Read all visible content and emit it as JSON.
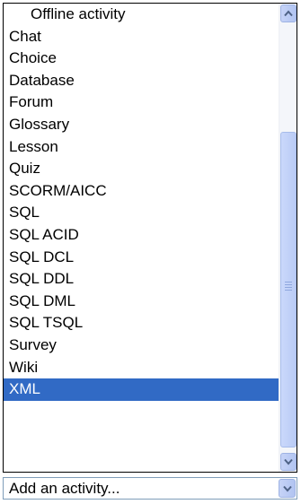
{
  "list": {
    "items": [
      {
        "label": "Offline activity"
      },
      {
        "label": "Chat"
      },
      {
        "label": "Choice"
      },
      {
        "label": "Database"
      },
      {
        "label": "Forum"
      },
      {
        "label": "Glossary"
      },
      {
        "label": "Lesson"
      },
      {
        "label": "Quiz"
      },
      {
        "label": "SCORM/AICC"
      },
      {
        "label": "SQL"
      },
      {
        "label": "SQL ACID"
      },
      {
        "label": "SQL DCL"
      },
      {
        "label": "SQL DDL"
      },
      {
        "label": "SQL DML"
      },
      {
        "label": "SQL TSQL"
      },
      {
        "label": "Survey"
      },
      {
        "label": "Wiki"
      },
      {
        "label": "XML"
      }
    ],
    "selected": "XML"
  },
  "scrollbar": {
    "up_icon": "chevron-up-icon",
    "down_icon": "chevron-down-icon"
  },
  "combo": {
    "value": "Add an activity...",
    "icon": "chevron-down-icon"
  },
  "colors": {
    "selection": "#316ac5",
    "border": "#000000",
    "scroll_button": "#c6d3f7"
  }
}
